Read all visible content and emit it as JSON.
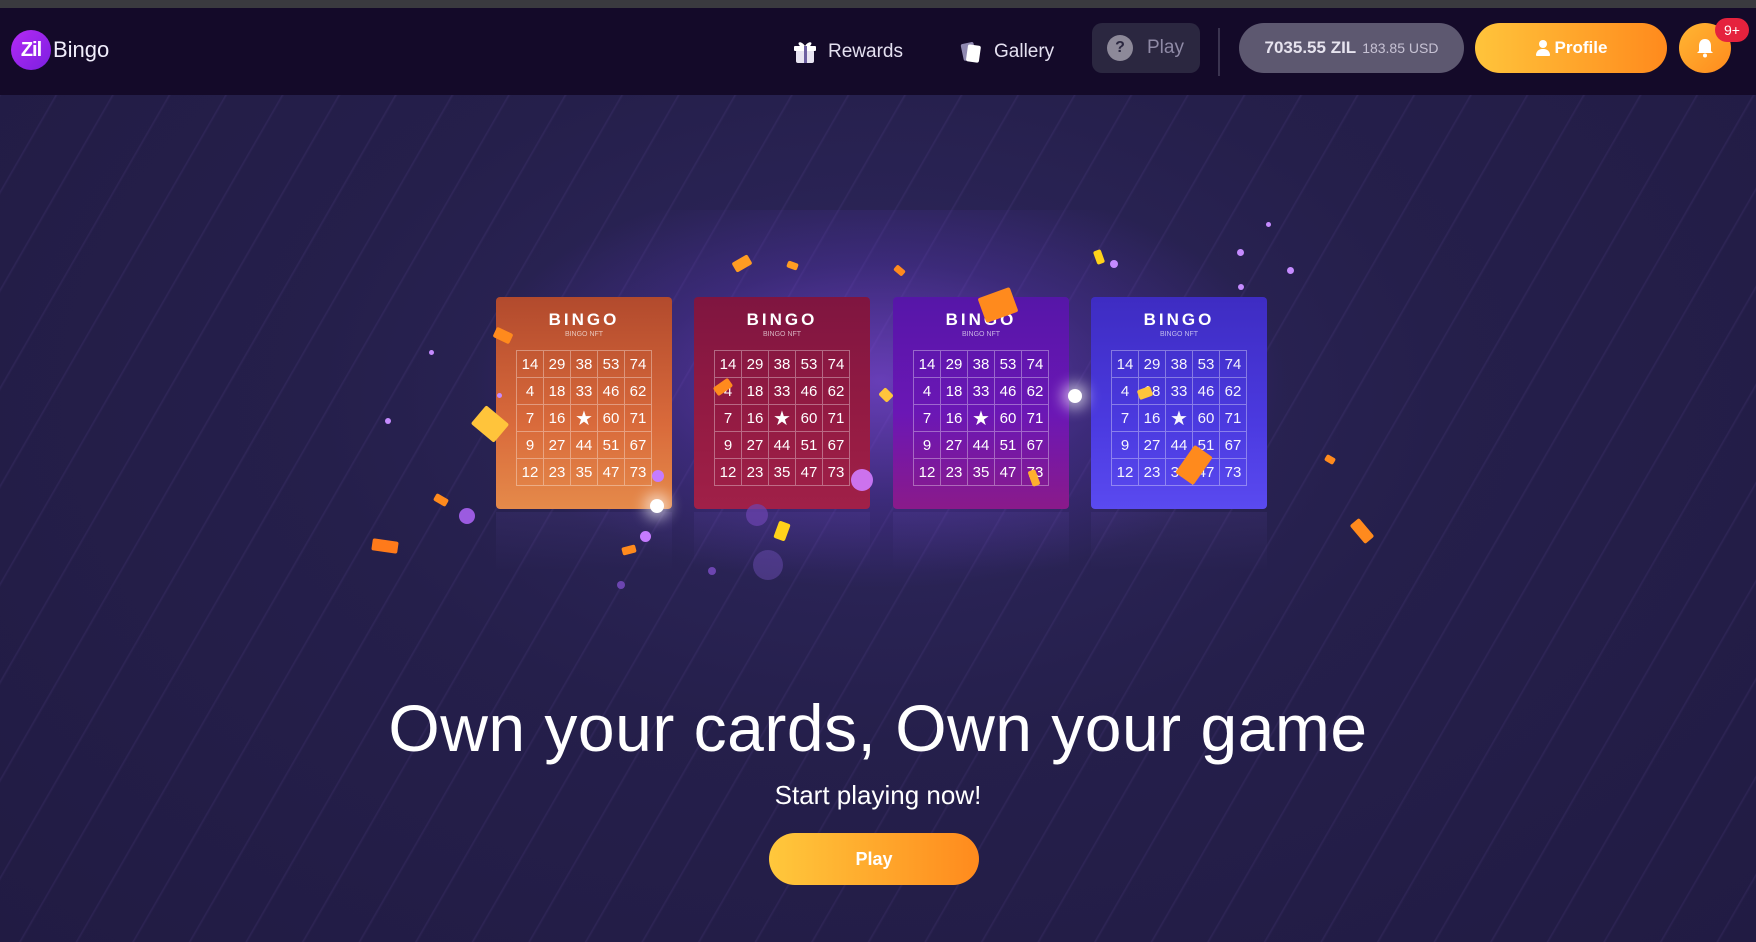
{
  "header": {
    "logo_badge": "Zil",
    "logo_word": "Bingo",
    "nav": {
      "rewards_label": "Rewards",
      "gallery_label": "Gallery",
      "play_label": "Play"
    },
    "balance": {
      "zil": "7035.55 ZIL",
      "usd": "183.85 USD"
    },
    "profile_label": "Profile",
    "notification_badge": "9+",
    "icons": [
      "rewards-icon",
      "gallery-icon",
      "play-help-icon",
      "person-icon",
      "bell-icon"
    ]
  },
  "cards": [
    {
      "title": "BINGO",
      "subtitle": "BINGO NFT",
      "color": "#d96a3b",
      "numbers": [
        [
          "14",
          "29",
          "38",
          "53",
          "74"
        ],
        [
          "4",
          "18",
          "33",
          "46",
          "62"
        ],
        [
          "7",
          "16",
          "★",
          "60",
          "71"
        ],
        [
          "9",
          "27",
          "44",
          "51",
          "67"
        ],
        [
          "12",
          "23",
          "35",
          "47",
          "73"
        ]
      ]
    },
    {
      "title": "BINGO",
      "subtitle": "BINGO NFT",
      "color": "#951b43",
      "numbers": [
        [
          "14",
          "29",
          "38",
          "53",
          "74"
        ],
        [
          "4",
          "18",
          "33",
          "46",
          "62"
        ],
        [
          "7",
          "16",
          "★",
          "60",
          "71"
        ],
        [
          "9",
          "27",
          "44",
          "51",
          "67"
        ],
        [
          "12",
          "23",
          "35",
          "47",
          "73"
        ]
      ]
    },
    {
      "title": "BINGO",
      "subtitle": "BINGO NFT",
      "color": "#6b17b5",
      "numbers": [
        [
          "14",
          "29",
          "38",
          "53",
          "74"
        ],
        [
          "4",
          "18",
          "33",
          "46",
          "62"
        ],
        [
          "7",
          "16",
          "★",
          "60",
          "71"
        ],
        [
          "9",
          "27",
          "44",
          "51",
          "67"
        ],
        [
          "12",
          "23",
          "35",
          "47",
          "73"
        ]
      ]
    },
    {
      "title": "BINGO",
      "subtitle": "BINGO NFT",
      "color": "#4b3ae0",
      "numbers": [
        [
          "14",
          "29",
          "38",
          "53",
          "74"
        ],
        [
          "4",
          "18",
          "33",
          "46",
          "62"
        ],
        [
          "7",
          "16",
          "★",
          "60",
          "71"
        ],
        [
          "9",
          "27",
          "44",
          "51",
          "67"
        ],
        [
          "12",
          "23",
          "35",
          "47",
          "73"
        ]
      ]
    }
  ],
  "hero": {
    "headline": "Own your cards, Own your game",
    "subline": "Start playing now!",
    "cta_label": "Play"
  },
  "colors": {
    "background": "#231e47",
    "header": "#140a29",
    "accent_orange": "#ff8a1d",
    "accent_yellow": "#ffc43b",
    "badge_red": "#e5223d"
  }
}
